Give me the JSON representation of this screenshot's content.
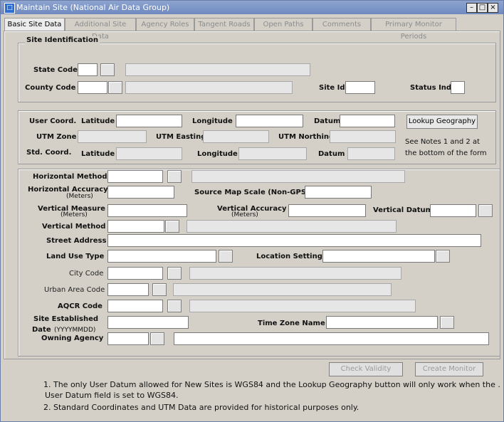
{
  "window": {
    "title": "Maintain Site (National Air Data Group)"
  },
  "tabs": [
    "Basic Site Data",
    "Additional Site Data",
    "Agency Roles",
    "Tangent Roads",
    "Open Paths",
    "Comments",
    "Primary Monitor Periods"
  ],
  "site_identification": {
    "title": "Site Identification",
    "state_code": "State Code",
    "county_code": "County Code",
    "site_id": "Site Id",
    "status_ind": "Status Ind"
  },
  "coordinates": {
    "user_coord": "User Coord.",
    "latitude": "Latitude",
    "longitude": "Longitude",
    "datum": "Datum",
    "utm_zone": "UTM Zone",
    "utm_easting": "UTM Easting",
    "utm_northing": "UTM Northing",
    "std_coord": "Std. Coord.",
    "lookup_button": "Lookup Geography",
    "see_notes_1": "See Notes 1 and 2 at",
    "see_notes_2": "the bottom of the form"
  },
  "details": {
    "horizontal_method": "Horizontal Method",
    "horizontal_accuracy": "Horizontal Accuracy",
    "meters": "(Meters)",
    "source_map_scale": "Source Map Scale (Non-GPS)",
    "vertical_measure": "Vertical Measure",
    "vertical_accuracy": "Vertical Accuracy",
    "vertical_datum": "Vertical Datum",
    "vertical_method": "Vertical Method",
    "street_address": "Street Address",
    "land_use_type": "Land Use Type",
    "location_setting": "Location Setting",
    "city_code": "City Code",
    "urban_area_code": "Urban Area Code",
    "aqcr_code": "AQCR Code",
    "site_established": "Site Established",
    "date_label": "Date",
    "date_format": "(YYYYMMDD)",
    "time_zone_name": "Time Zone Name",
    "owning_agency": "Owning Agency"
  },
  "buttons": {
    "check_validity": "Check Validity",
    "create_monitor": "Create Monitor"
  },
  "notes": {
    "note1_line1": "1. The only User Datum allowed for New Sites is WGS84 and the Lookup Geography button will only work when the .",
    "note1_line2": "User Datum field is set to WGS84.",
    "note2": "2. Standard Coordinates and UTM Data are provided for historical purposes only."
  },
  "icons": {
    "app": "app-icon",
    "minimize": "minimize-icon",
    "maximize": "maximize-icon",
    "close": "close-icon"
  }
}
